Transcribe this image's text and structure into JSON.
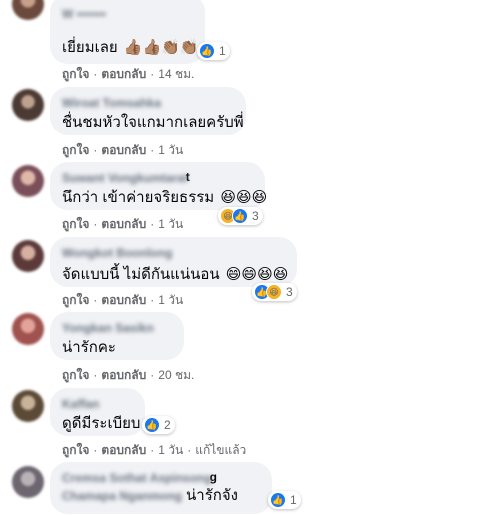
{
  "comments": [
    {
      "author": "W ••••••• ",
      "text": "เยี่ยมเลย",
      "emojis": "👍🏽👍🏽👏🏽👏🏽",
      "reaction_count": "1",
      "like": "ถูกใจ",
      "reply": "ตอบกลับ",
      "time": "14 ชม."
    },
    {
      "author": "Wiroat Tomsahka",
      "text": "ชื่นชมหัวใจแกมากเลยครับพี่",
      "like": "ถูกใจ",
      "reply": "ตอบกลับ",
      "time": "1 วัน"
    },
    {
      "author": "Suwant Vongkumtarat",
      "author_tail": "t",
      "text": "นึกว่า เข้าค่ายจริยธรรม",
      "emojis": "😆😆😆",
      "reaction_count": "3",
      "like": "ถูกใจ",
      "reply": "ตอบกลับ",
      "time": "1 วัน"
    },
    {
      "author": "Wongkot Boonlong",
      "text": "จัดแบบนี้ ไม่ดีกันแน่นอน",
      "emojis": "😄😄😆😆",
      "reaction_count": "3",
      "like": "ถูกใจ",
      "reply": "ตอบกลับ",
      "time": "1 วัน"
    },
    {
      "author": "Yongkan Sasikn",
      "text": "น่ารักคะ",
      "like": "ถูกใจ",
      "reply": "ตอบกลับ",
      "time": "20 ชม."
    },
    {
      "author": "Kaffan",
      "text": "ดูดีมีระเบียบ",
      "reaction_count": "2",
      "like": "ถูกใจ",
      "reply": "ตอบกลับ",
      "time": "1 วัน",
      "edited": "แก้ไขแล้ว"
    },
    {
      "author": "Cremsa Sothat Aspinsong",
      "author_tail": "g",
      "author2": "Chamapa Nganmong",
      "text": "น่ารักจัง",
      "reaction_count": "1"
    }
  ],
  "colors": {
    "bubble": "#f0f2f5",
    "like_blue": "#1877f2",
    "haha_yellow": "#f7b125",
    "meta_gray": "#65676b"
  },
  "icons": {
    "like": "thumbs-up-icon",
    "haha": "laughing-face-icon"
  }
}
